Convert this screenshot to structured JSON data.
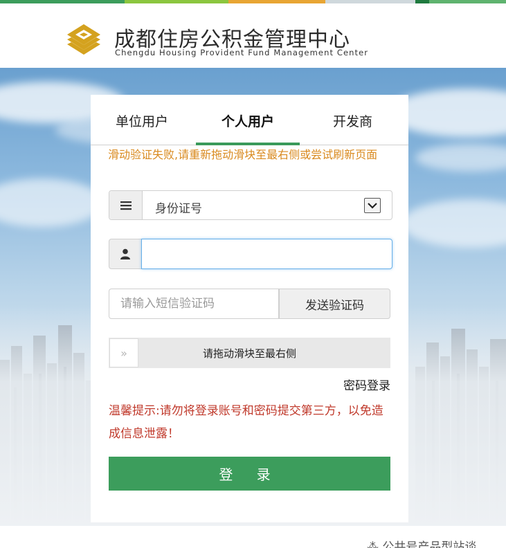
{
  "header": {
    "title_cn": "成都住房公积金管理中心",
    "title_en": "Chengdu Housing Provident Fund Management Center",
    "logo_icon": "layered-diamond-logo-icon",
    "brand_color": "#d4a21f"
  },
  "colors": {
    "accent": "#3c9d5c",
    "error": "#d98a1f",
    "warning": "#c0392b",
    "focus": "#66afe9"
  },
  "tabs": [
    {
      "label": "单位用户",
      "active": false
    },
    {
      "label": "个人用户",
      "active": true
    },
    {
      "label": "开发商",
      "active": false
    }
  ],
  "form": {
    "error_message": "滑动验证失败,请重新拖动滑块至最右侧或尝试刷新页面",
    "id_type": {
      "icon": "list-icon",
      "value": "身份证号"
    },
    "username": {
      "icon": "user-icon",
      "value": ""
    },
    "sms": {
      "placeholder": "请输入短信验证码",
      "button_label": "发送验证码"
    },
    "slider": {
      "handle_icon": "double-chevron-right-icon",
      "handle_glyph": "»",
      "label": "请拖动滑块至最右侧"
    },
    "password_login_link": "密码登录",
    "warning_tip": "温馨提示:请勿将登录账号和密码提交第三方，以免造成信息泄露！",
    "submit_label": "登 录"
  },
  "watermark": "⁂ 公共号产品型站谈"
}
